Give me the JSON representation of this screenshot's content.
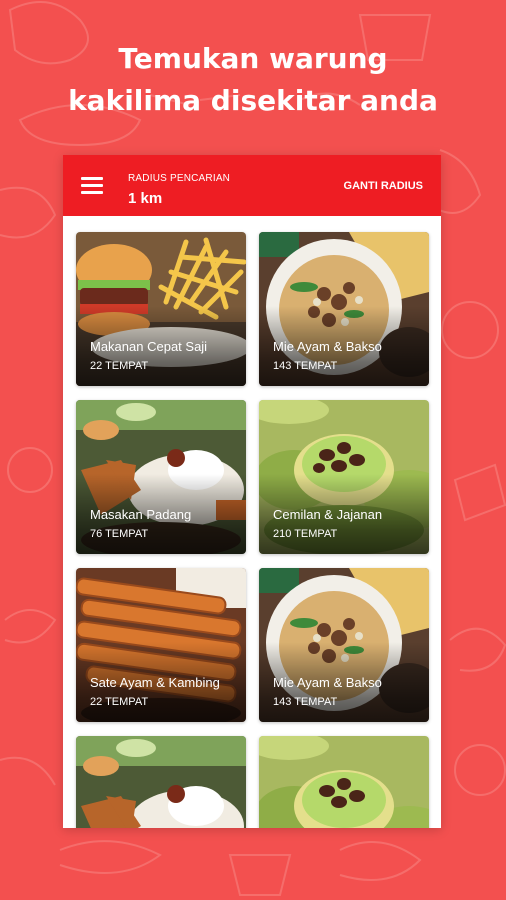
{
  "headline": {
    "line1": "Temukan warung",
    "line2": "kakilima disekitar anda"
  },
  "app_bar": {
    "menu_icon": "hamburger-menu-icon",
    "radius_label": "RADIUS PENCARIAN",
    "radius_value": "1 km",
    "change_radius": "GANTI RADIUS"
  },
  "categories": [
    {
      "name": "Makanan Cepat Saji",
      "count": "22 TEMPAT"
    },
    {
      "name": "Mie Ayam & Bakso",
      "count": "143 TEMPAT"
    },
    {
      "name": "Masakan Padang",
      "count": "76 TEMPAT"
    },
    {
      "name": "Cemilan & Jajanan",
      "count": "210 TEMPAT"
    },
    {
      "name": "Sate Ayam & Kambing",
      "count": "22 TEMPAT"
    },
    {
      "name": "Mie Ayam & Bakso",
      "count": "143 TEMPAT"
    }
  ],
  "colors": {
    "background": "#f3504f",
    "app_bar": "#ee1d23",
    "card_text": "#ffffff"
  }
}
